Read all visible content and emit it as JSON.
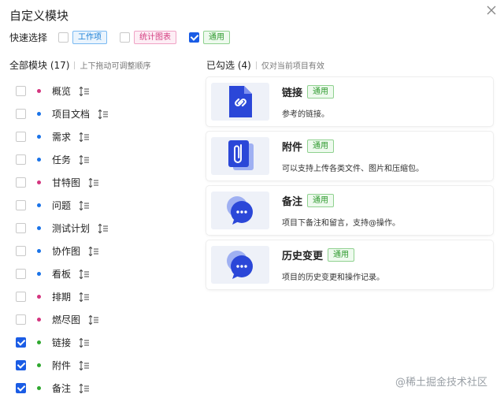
{
  "dialog": {
    "title": "自定义模块"
  },
  "quick_select": {
    "label": "快速选择",
    "options": [
      {
        "tag": "工作项",
        "checked": false,
        "color": "blue"
      },
      {
        "tag": "统计图表",
        "checked": false,
        "color": "pink"
      },
      {
        "tag": "通用",
        "checked": true,
        "color": "green"
      }
    ]
  },
  "all_modules": {
    "title": "全部模块 (17)",
    "hint": "上下拖动可调整顺序",
    "items": [
      {
        "label": "概览",
        "checked": false,
        "dot_color": "#d4357f"
      },
      {
        "label": "项目文档",
        "checked": false,
        "dot_color": "#1a73e8"
      },
      {
        "label": "需求",
        "checked": false,
        "dot_color": "#1a73e8"
      },
      {
        "label": "任务",
        "checked": false,
        "dot_color": "#1a73e8"
      },
      {
        "label": "甘特图",
        "checked": false,
        "dot_color": "#d4357f"
      },
      {
        "label": "问题",
        "checked": false,
        "dot_color": "#1a73e8"
      },
      {
        "label": "测试计划",
        "checked": false,
        "dot_color": "#1a73e8"
      },
      {
        "label": "协作图",
        "checked": false,
        "dot_color": "#1a73e8"
      },
      {
        "label": "看板",
        "checked": false,
        "dot_color": "#1a73e8"
      },
      {
        "label": "排期",
        "checked": false,
        "dot_color": "#d4357f"
      },
      {
        "label": "燃尽图",
        "checked": false,
        "dot_color": "#d4357f"
      },
      {
        "label": "链接",
        "checked": true,
        "dot_color": "#2fa82f"
      },
      {
        "label": "附件",
        "checked": true,
        "dot_color": "#2fa82f"
      },
      {
        "label": "备注",
        "checked": true,
        "dot_color": "#2fa82f"
      }
    ]
  },
  "selected": {
    "title": "已勾选 (4)",
    "hint": "仅对当前项目有效",
    "cards": [
      {
        "title": "链接",
        "tag": "通用",
        "desc": "参考的链接。",
        "icon": "link-document-icon"
      },
      {
        "title": "附件",
        "tag": "通用",
        "desc": "可以支持上传各类文件、图片和压缩包。",
        "icon": "paperclip-document-icon"
      },
      {
        "title": "备注",
        "tag": "通用",
        "desc": "项目下备注和留言，支持@操作。",
        "icon": "chat-bubble-icon"
      },
      {
        "title": "历史变更",
        "tag": "通用",
        "desc": "项目的历史变更和操作记录。",
        "icon": "chat-bubble-icon"
      }
    ]
  },
  "watermark": "@稀土掘金技术社区"
}
